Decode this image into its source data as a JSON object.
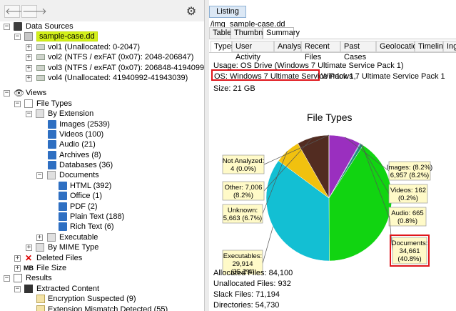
{
  "nav": {
    "back_glyph": "🡐",
    "forward_glyph": "🡒",
    "settings_glyph": "⚙"
  },
  "tree": {
    "data_sources": "Data Sources",
    "image_name": "sample-case.dd",
    "volumes": [
      "vol1 (Unallocated: 0-2047)",
      "vol2 (NTFS / exFAT (0x07): 2048-206847)",
      "vol3 (NTFS / exFAT (0x07): 206848-41940991)",
      "vol4 (Unallocated: 41940992-41943039)"
    ],
    "views": "Views",
    "file_types": "File Types",
    "by_extension": "By Extension",
    "ext_items": [
      "Images (2539)",
      "Videos (100)",
      "Audio (21)",
      "Archives (8)",
      "Databases (36)"
    ],
    "documents": "Documents",
    "doc_items": [
      "HTML (392)",
      "Office (1)",
      "PDF (2)",
      "Plain Text (188)",
      "Rich Text (6)"
    ],
    "executable": "Executable",
    "by_mime": "By MIME Type",
    "deleted_files": "Deleted Files",
    "file_size": "File Size",
    "results": "Results",
    "extracted_content": "Extracted Content",
    "encryption": "Encryption Suspected (9)",
    "ext_mismatch": "Extension Mismatch Detected (55)"
  },
  "listing": {
    "tab_label": "Listing",
    "path": "/img_sample-case.dd",
    "subtabs": [
      "Table",
      "Thumbnail",
      "Summary"
    ],
    "view_tabs": [
      "Types",
      "User Activity",
      "Analysis",
      "Recent Files",
      "Past Cases",
      "Geolocation",
      "Timeline",
      "Inge"
    ]
  },
  "summary": {
    "usage": "Usage: OS Drive (Windows 7 Ultimate Service Pack 1)",
    "os_boxed": "OS: Windows 7 Ultimate Service Pack 1,",
    "os_rest": "Windows 7 Ultimate Service Pack 1",
    "size": "Size: 21 GB",
    "allocated": "Allocated Files: 84,100",
    "unallocated": "Unallocated Files: 932",
    "slack": "Slack Files: 71,194",
    "directories": "Directories: 54,730"
  },
  "colors": {
    "highlight": "#d3f01a",
    "red_box": "#e0161b",
    "tab_blue": "#dce8f5"
  },
  "chart_data": {
    "type": "pie",
    "title": "File Types",
    "slices": [
      {
        "name": "Images",
        "value": 6957,
        "percent": 8.2,
        "label_lines": [
          "Images: (8.2%)",
          "6,957 (8.2%)"
        ],
        "color": "#9a2fbf"
      },
      {
        "name": "Videos",
        "value": 162,
        "percent": 0.2,
        "label_lines": [
          "Videos: 162",
          "(0.2%)"
        ],
        "color": "#2a46c2"
      },
      {
        "name": "Audio",
        "value": 665,
        "percent": 0.8,
        "label_lines": [
          "Audio: 665",
          "(0.8%)"
        ],
        "color": "#1f8f7a"
      },
      {
        "name": "Documents",
        "value": 34661,
        "percent": 40.8,
        "label_lines": [
          "Documents:",
          "34,661",
          "(40.8%)"
        ],
        "color": "#11d411"
      },
      {
        "name": "Executables",
        "value": 29914,
        "percent": 35.2,
        "label_lines": [
          "Executables:",
          "29,914",
          "(35.2%)"
        ],
        "color": "#13bfd3"
      },
      {
        "name": "Unknown",
        "value": 5663,
        "percent": 6.7,
        "label_lines": [
          "Unknown:",
          "5,663 (6.7%)"
        ],
        "color": "#f1c10f"
      },
      {
        "name": "Other",
        "value": 7006,
        "percent": 8.2,
        "label_lines": [
          "Other: 7,006",
          "(8.2%)"
        ],
        "color": "#522c21"
      },
      {
        "name": "Not Analyzed",
        "value": 4,
        "percent": 0.0,
        "label_lines": [
          "Not Analyzed:",
          "4 (0.0%)"
        ],
        "color": "#7a7a7a"
      }
    ]
  }
}
